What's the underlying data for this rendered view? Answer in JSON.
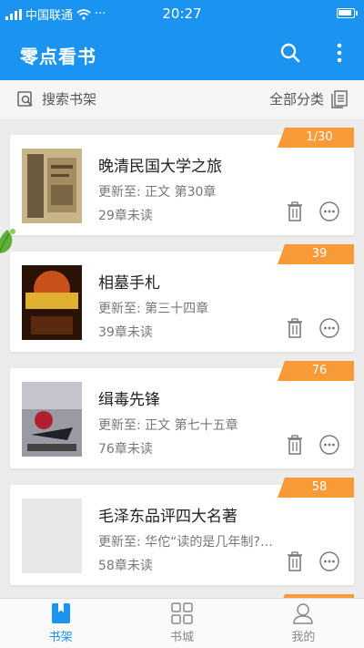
{
  "status_bar": {
    "carrier": "中国联通",
    "extra": "···",
    "time": "20:27",
    "battery_level": 0.9
  },
  "app_bar": {
    "title": "零点看书"
  },
  "toolbar": {
    "search_label": "搜索书架",
    "categories_label": "全部分类"
  },
  "books": [
    {
      "badge": "1/30",
      "title": "晚清民国大学之旅",
      "update": "更新至: 正文 第30章",
      "unread": "29章未读",
      "cover_color": "#6b5a3e"
    },
    {
      "badge": "39",
      "title": "相墓手札",
      "update": "更新至: 第三十四章",
      "unread": "39章未读",
      "cover_color": "#8a3a12"
    },
    {
      "badge": "76",
      "title": "缉毒先锋",
      "update": "更新至: 正文 第七十五章",
      "unread": "76章未读",
      "cover_color": "#7a7a80"
    },
    {
      "badge": "58",
      "title": "毛泽东品评四大名著",
      "update": "更新至: 华佗“读的是几年制?…",
      "unread": "58章未读",
      "cover_color": "#e8e8e8"
    }
  ],
  "bottom_nav": {
    "tabs": [
      {
        "label": "书架",
        "active": true
      },
      {
        "label": "书城",
        "active": false
      },
      {
        "label": "我的",
        "active": false
      }
    ]
  },
  "colors": {
    "primary": "#1a94f0",
    "badge": "#f79a37"
  }
}
